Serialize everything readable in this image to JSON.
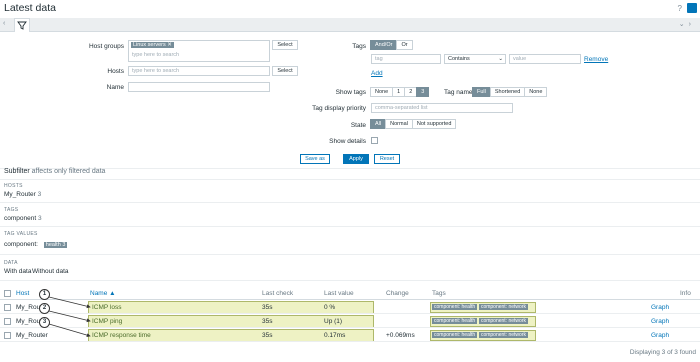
{
  "page": {
    "title": "Latest data",
    "help": "?"
  },
  "filter": {
    "host_groups_label": "Host groups",
    "host_groups_chip": "Linux servers",
    "host_groups_placeholder": "type here to search",
    "hosts_label": "Hosts",
    "hosts_placeholder": "type here to search",
    "name_label": "Name",
    "select_label": "Select",
    "tags_label": "Tags",
    "tags_andor": "And/Or",
    "tags_or": "Or",
    "tag_placeholder": "tag",
    "tag_operator": "Contains",
    "value_placeholder": "value",
    "remove_label": "Remove",
    "add_label": "Add",
    "show_tags_label": "Show tags",
    "show_tags_options": [
      "None",
      "1",
      "2",
      "3"
    ],
    "tag_name_label": "Tag name",
    "tag_name_options": [
      "Full",
      "Shortened",
      "None"
    ],
    "tag_priority_label": "Tag display priority",
    "tag_priority_placeholder": "comma-separated list",
    "state_label": "State",
    "state_options": [
      "All",
      "Normal",
      "Not supported"
    ],
    "show_details_label": "Show details",
    "save_as": "Save as",
    "apply": "Apply",
    "reset": "Reset"
  },
  "subfilter": {
    "title": "Subfilter",
    "note": "affects only filtered data",
    "hosts_h": "HOSTS",
    "host_item": "My_Router",
    "host_count": "3",
    "tags_h": "TAGS",
    "tag_item": "component",
    "tag_count": "3",
    "tagvalues_h": "TAG VALUES",
    "tv_key": "component:",
    "tv_val": "health",
    "tv_count": "3",
    "data_h": "DATA",
    "with_data": "With data",
    "without_data": "Without data"
  },
  "table": {
    "headers": {
      "host": "Host",
      "name": "Name ▲",
      "last_check": "Last check",
      "last_value": "Last value",
      "change": "Change",
      "tags": "Tags",
      "info": "Info"
    },
    "rows": [
      {
        "host": "My_Router",
        "name": "ICMP loss",
        "last_check": "35s",
        "last_value": "0 %",
        "change": "",
        "tags": [
          "component: health",
          "component: network"
        ],
        "graph": "Graph"
      },
      {
        "host": "My_Router",
        "name": "ICMP ping",
        "last_check": "35s",
        "last_value": "Up (1)",
        "change": "",
        "tags": [
          "component: health",
          "component: network"
        ],
        "graph": "Graph"
      },
      {
        "host": "My_Router",
        "name": "ICMP response time",
        "last_check": "35s",
        "last_value": "0.17ms",
        "change": "+0.069ms",
        "tags": [
          "component: health",
          "component: network"
        ],
        "graph": "Graph"
      }
    ],
    "footer": "Displaying 3 of 3 found",
    "callouts": [
      "1",
      "2",
      "3"
    ]
  }
}
